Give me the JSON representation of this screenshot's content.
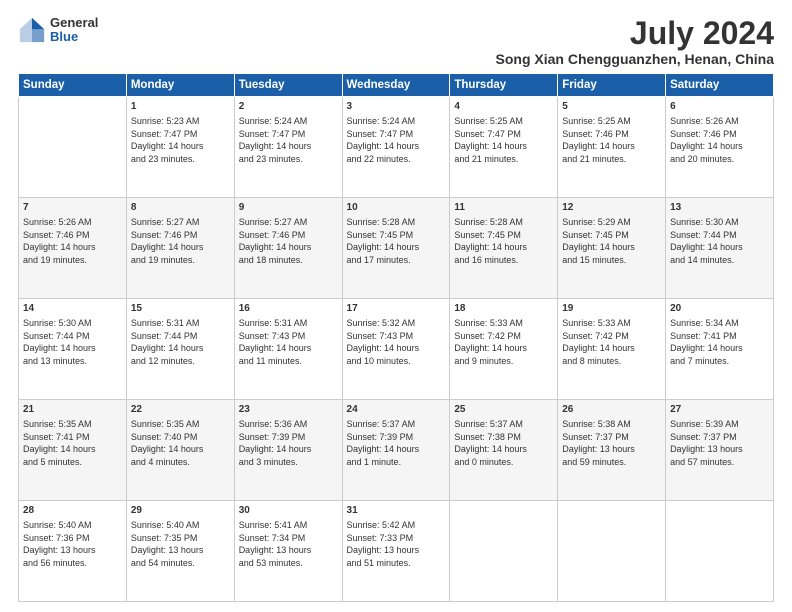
{
  "logo": {
    "general": "General",
    "blue": "Blue"
  },
  "header": {
    "title": "July 2024",
    "subtitle": "Song Xian Chengguanzhen, Henan, China"
  },
  "weekdays": [
    "Sunday",
    "Monday",
    "Tuesday",
    "Wednesday",
    "Thursday",
    "Friday",
    "Saturday"
  ],
  "weeks": [
    [
      {
        "day": "",
        "content": ""
      },
      {
        "day": "1",
        "content": "Sunrise: 5:23 AM\nSunset: 7:47 PM\nDaylight: 14 hours\nand 23 minutes."
      },
      {
        "day": "2",
        "content": "Sunrise: 5:24 AM\nSunset: 7:47 PM\nDaylight: 14 hours\nand 23 minutes."
      },
      {
        "day": "3",
        "content": "Sunrise: 5:24 AM\nSunset: 7:47 PM\nDaylight: 14 hours\nand 22 minutes."
      },
      {
        "day": "4",
        "content": "Sunrise: 5:25 AM\nSunset: 7:47 PM\nDaylight: 14 hours\nand 21 minutes."
      },
      {
        "day": "5",
        "content": "Sunrise: 5:25 AM\nSunset: 7:46 PM\nDaylight: 14 hours\nand 21 minutes."
      },
      {
        "day": "6",
        "content": "Sunrise: 5:26 AM\nSunset: 7:46 PM\nDaylight: 14 hours\nand 20 minutes."
      }
    ],
    [
      {
        "day": "7",
        "content": "Sunrise: 5:26 AM\nSunset: 7:46 PM\nDaylight: 14 hours\nand 19 minutes."
      },
      {
        "day": "8",
        "content": "Sunrise: 5:27 AM\nSunset: 7:46 PM\nDaylight: 14 hours\nand 19 minutes."
      },
      {
        "day": "9",
        "content": "Sunrise: 5:27 AM\nSunset: 7:46 PM\nDaylight: 14 hours\nand 18 minutes."
      },
      {
        "day": "10",
        "content": "Sunrise: 5:28 AM\nSunset: 7:45 PM\nDaylight: 14 hours\nand 17 minutes."
      },
      {
        "day": "11",
        "content": "Sunrise: 5:28 AM\nSunset: 7:45 PM\nDaylight: 14 hours\nand 16 minutes."
      },
      {
        "day": "12",
        "content": "Sunrise: 5:29 AM\nSunset: 7:45 PM\nDaylight: 14 hours\nand 15 minutes."
      },
      {
        "day": "13",
        "content": "Sunrise: 5:30 AM\nSunset: 7:44 PM\nDaylight: 14 hours\nand 14 minutes."
      }
    ],
    [
      {
        "day": "14",
        "content": "Sunrise: 5:30 AM\nSunset: 7:44 PM\nDaylight: 14 hours\nand 13 minutes."
      },
      {
        "day": "15",
        "content": "Sunrise: 5:31 AM\nSunset: 7:44 PM\nDaylight: 14 hours\nand 12 minutes."
      },
      {
        "day": "16",
        "content": "Sunrise: 5:31 AM\nSunset: 7:43 PM\nDaylight: 14 hours\nand 11 minutes."
      },
      {
        "day": "17",
        "content": "Sunrise: 5:32 AM\nSunset: 7:43 PM\nDaylight: 14 hours\nand 10 minutes."
      },
      {
        "day": "18",
        "content": "Sunrise: 5:33 AM\nSunset: 7:42 PM\nDaylight: 14 hours\nand 9 minutes."
      },
      {
        "day": "19",
        "content": "Sunrise: 5:33 AM\nSunset: 7:42 PM\nDaylight: 14 hours\nand 8 minutes."
      },
      {
        "day": "20",
        "content": "Sunrise: 5:34 AM\nSunset: 7:41 PM\nDaylight: 14 hours\nand 7 minutes."
      }
    ],
    [
      {
        "day": "21",
        "content": "Sunrise: 5:35 AM\nSunset: 7:41 PM\nDaylight: 14 hours\nand 5 minutes."
      },
      {
        "day": "22",
        "content": "Sunrise: 5:35 AM\nSunset: 7:40 PM\nDaylight: 14 hours\nand 4 minutes."
      },
      {
        "day": "23",
        "content": "Sunrise: 5:36 AM\nSunset: 7:39 PM\nDaylight: 14 hours\nand 3 minutes."
      },
      {
        "day": "24",
        "content": "Sunrise: 5:37 AM\nSunset: 7:39 PM\nDaylight: 14 hours\nand 1 minute."
      },
      {
        "day": "25",
        "content": "Sunrise: 5:37 AM\nSunset: 7:38 PM\nDaylight: 14 hours\nand 0 minutes."
      },
      {
        "day": "26",
        "content": "Sunrise: 5:38 AM\nSunset: 7:37 PM\nDaylight: 13 hours\nand 59 minutes."
      },
      {
        "day": "27",
        "content": "Sunrise: 5:39 AM\nSunset: 7:37 PM\nDaylight: 13 hours\nand 57 minutes."
      }
    ],
    [
      {
        "day": "28",
        "content": "Sunrise: 5:40 AM\nSunset: 7:36 PM\nDaylight: 13 hours\nand 56 minutes."
      },
      {
        "day": "29",
        "content": "Sunrise: 5:40 AM\nSunset: 7:35 PM\nDaylight: 13 hours\nand 54 minutes."
      },
      {
        "day": "30",
        "content": "Sunrise: 5:41 AM\nSunset: 7:34 PM\nDaylight: 13 hours\nand 53 minutes."
      },
      {
        "day": "31",
        "content": "Sunrise: 5:42 AM\nSunset: 7:33 PM\nDaylight: 13 hours\nand 51 minutes."
      },
      {
        "day": "",
        "content": ""
      },
      {
        "day": "",
        "content": ""
      },
      {
        "day": "",
        "content": ""
      }
    ]
  ]
}
